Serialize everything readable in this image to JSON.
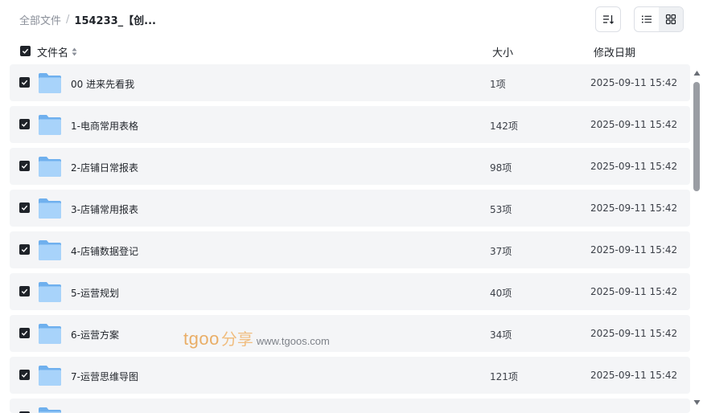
{
  "breadcrumb": {
    "root": "全部文件",
    "separator": "/",
    "current": "154233_【创..."
  },
  "columns": {
    "name": "文件名",
    "size": "大小",
    "modified": "修改日期"
  },
  "rows": [
    {
      "name": "00 进来先看我",
      "size": "1项",
      "modified": "2025-09-11 15:42",
      "checked": true
    },
    {
      "name": "1-电商常用表格",
      "size": "142项",
      "modified": "2025-09-11 15:42",
      "checked": true
    },
    {
      "name": "2-店铺日常报表",
      "size": "98项",
      "modified": "2025-09-11 15:42",
      "checked": true
    },
    {
      "name": "3-店铺常用报表",
      "size": "53项",
      "modified": "2025-09-11 15:42",
      "checked": true
    },
    {
      "name": "4-店铺数据登记",
      "size": "37项",
      "modified": "2025-09-11 15:42",
      "checked": true
    },
    {
      "name": "5-运营规划",
      "size": "40项",
      "modified": "2025-09-11 15:42",
      "checked": true
    },
    {
      "name": "6-运营方案",
      "size": "34项",
      "modified": "2025-09-11 15:42",
      "checked": true
    },
    {
      "name": "7-运营思维导图",
      "size": "121项",
      "modified": "2025-09-11 15:42",
      "checked": true
    }
  ],
  "watermark": {
    "brand": "tgoo",
    "share": "分享",
    "url": "www.tgoos.com"
  },
  "icons": {
    "sort": "sort-order-icon",
    "list_view": "list-view-icon",
    "grid_view": "grid-view-icon",
    "folder": "folder-icon",
    "check": "checkmark-icon"
  },
  "colors": {
    "folder": "#8cc3f5",
    "row_bg": "#f4f5f7",
    "checkbox": "#1f2329",
    "watermark": "#e8a24f"
  }
}
